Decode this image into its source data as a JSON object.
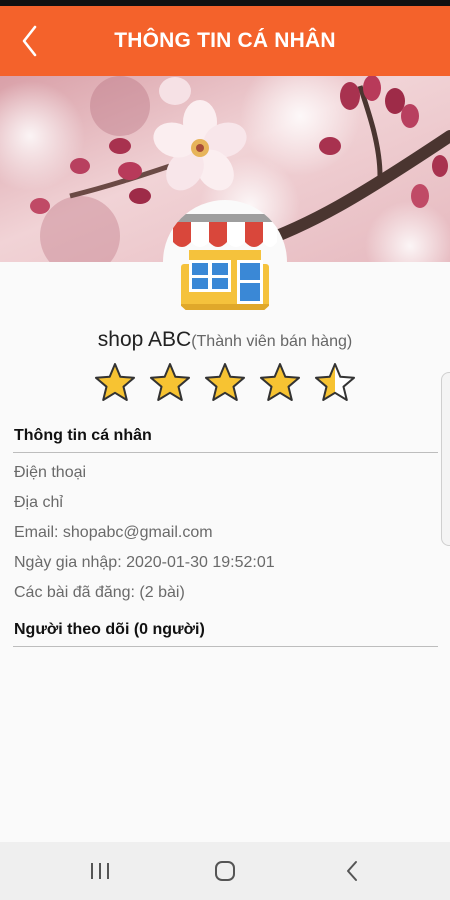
{
  "header": {
    "title": "THÔNG TIN CÁ NHÂN",
    "back_icon": "chevron-left-icon"
  },
  "colors": {
    "accent": "#f4622b",
    "star_fill": "#f7c332",
    "star_outline": "#333333",
    "background": "#fafafa",
    "divider": "#bdbdbd"
  },
  "banner": {
    "image": "cherry-blossom-photo"
  },
  "profile": {
    "avatar_icon": "store-icon",
    "shop_name": "shop ABC",
    "role": "(Thành viên bán hàng)",
    "rating": 4.5,
    "rating_max": 5
  },
  "personal_info": {
    "title": "Thông tin cá nhân",
    "phone_label": "Điện thoại",
    "address_label": "Địa chỉ",
    "email": "Email: shopabc@gmail.com",
    "join_date": "Ngày gia nhập: 2020-01-30 19:52:01",
    "posts": "Các bài đã đăng: (2 bài)"
  },
  "followers": {
    "title": "Người theo dõi (0 người)"
  },
  "navbar": {
    "recent_icon": "recent-apps-icon",
    "home_icon": "home-icon",
    "back_icon": "back-icon"
  }
}
